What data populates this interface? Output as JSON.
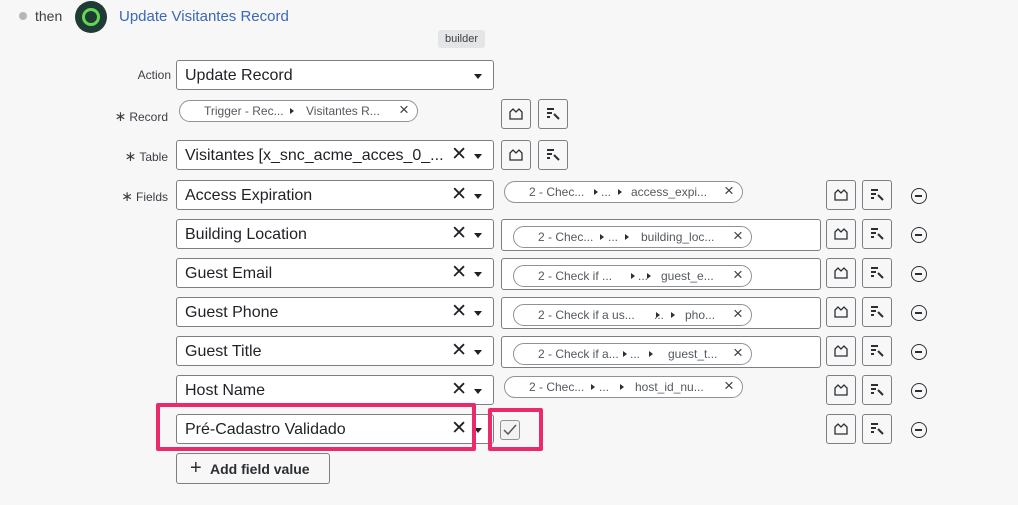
{
  "header": {
    "then_label": "then",
    "step_title": "Update Visitantes Record",
    "tooltip": "builder"
  },
  "action": {
    "label": "Action",
    "value": "Update Record"
  },
  "record": {
    "label": "Record",
    "pill": [
      "Trigger - Rec...",
      "Visitantes R..."
    ]
  },
  "table": {
    "label": "Table",
    "value": "Visitantes [x_snc_acme_acces_0_..."
  },
  "fields": {
    "label": "Fields",
    "rows": [
      {
        "field": "Access Expiration",
        "pill": [
          "2 - Chec...",
          "...",
          "access_expi..."
        ]
      },
      {
        "field": "Building Location",
        "pill": [
          "2 - Chec...",
          "...",
          "building_loc..."
        ]
      },
      {
        "field": "Guest Email",
        "pill": [
          "2 - Check if ...",
          "...",
          "guest_e..."
        ]
      },
      {
        "field": "Guest Phone",
        "pill": [
          "2 - Check if a us...",
          "...",
          "pho..."
        ]
      },
      {
        "field": "Guest Title",
        "pill": [
          "2 - Check if a...",
          "...",
          "guest_t..."
        ]
      },
      {
        "field": "Host Name",
        "pill": [
          "2 - Chec...",
          "...",
          "host_id_nu..."
        ]
      },
      {
        "field": "Pré-Cadastro Validado",
        "checked": true
      }
    ]
  },
  "add_field_button": "Add field value",
  "icons": {
    "required": "asterisk-icon",
    "clear": "x-icon",
    "data_pill_picker": "data-pill-picker-icon",
    "transform": "transform-icon",
    "remove": "minus-circle-icon"
  },
  "colors": {
    "highlight": "#ea2a6a",
    "link": "#3a67b6",
    "logo_ring": "#62d84e"
  }
}
